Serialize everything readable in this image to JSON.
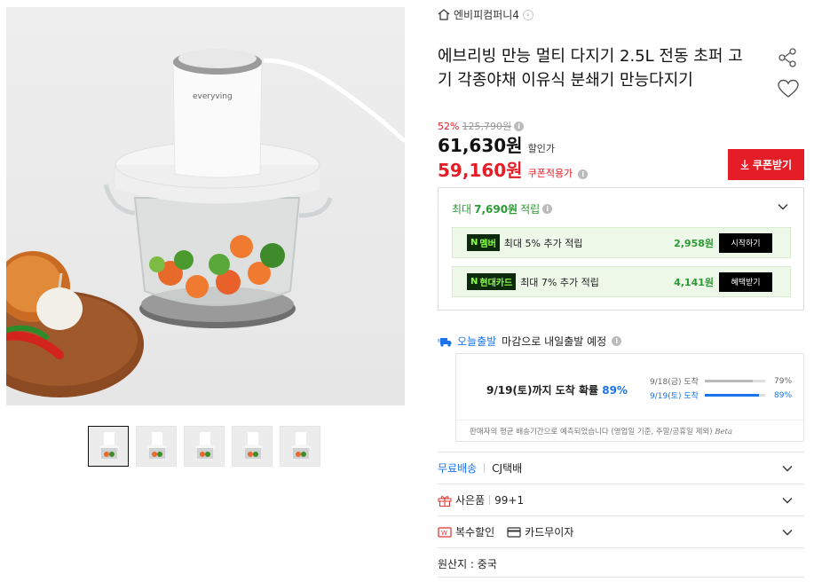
{
  "product": {
    "store_name": "엔비피컴퍼니4",
    "title": "에브리빙 만능 멀티 다지기 2.5L 전동 초퍼 고기 각종야채 이유식 분쇄기 만능다지기",
    "brand_text": "everyving"
  },
  "price": {
    "discount_rate": "52%",
    "original": "125,790원",
    "sale": "61,630원",
    "sale_label": "할인가",
    "coupon": "59,160원",
    "coupon_label": "쿠폰적용가",
    "coupon_button": "쿠폰받기"
  },
  "points": {
    "head_prefix": "최대",
    "head_amount": "7,690원",
    "head_suffix": "적립",
    "rows": [
      {
        "tag": "멤버",
        "desc": "최대 5% 추가 적립",
        "amount": "2,958원",
        "action": "시작하기"
      },
      {
        "tag": "현대카드",
        "desc": "최대 7% 추가 적립",
        "amount": "4,141원",
        "action": "혜택받기"
      }
    ]
  },
  "shipping": {
    "fast_label": "오늘출발",
    "fast_desc": "마감으로 내일출발 예정",
    "eta_main": "9/19(토)까지 도착 확률",
    "eta_pct": "89%",
    "rows": [
      {
        "date": "9/18(금) 도착",
        "value": "79%",
        "fraction": 0.79
      },
      {
        "date": "9/19(토) 도착",
        "value": "89%",
        "fraction": 0.89
      }
    ],
    "note": "판매자의 평균 배송기간으로 예측되었습니다 (영업일 기준, 주말/공휴일 제외)",
    "beta": "Beta"
  },
  "options": {
    "delivery_free": "무료배송",
    "courier": "CJ택배",
    "gift_label": "사은품",
    "gift_value": "99+1",
    "multi_discount": "복수할인",
    "card_interest": "카드무이자",
    "origin": "원산지 : 중국"
  },
  "colors": {
    "accent_red": "#e51d27",
    "point_green": "#2b9a34",
    "link_blue": "#1a73e8"
  }
}
